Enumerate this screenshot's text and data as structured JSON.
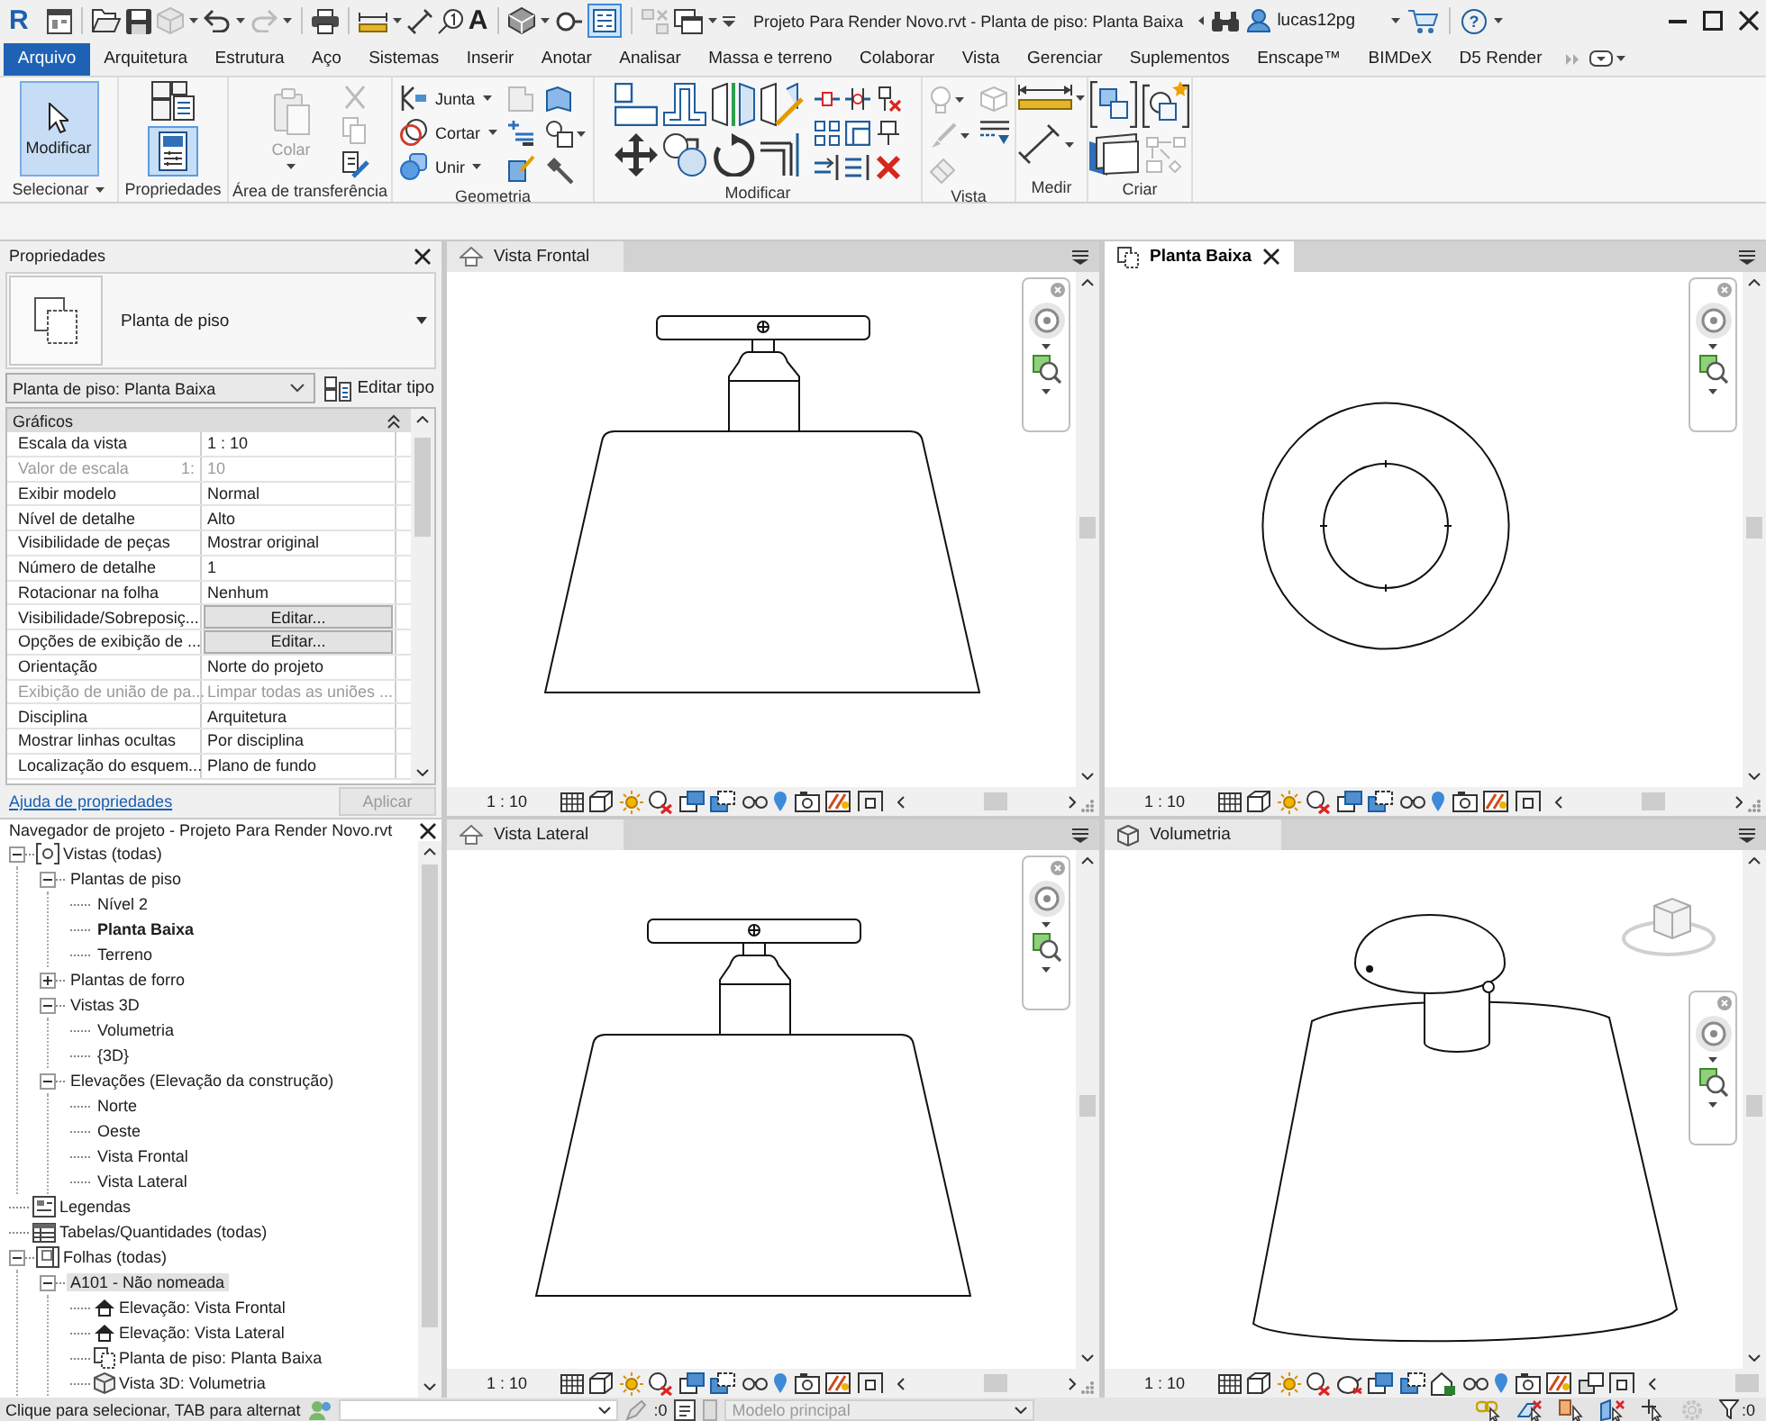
{
  "title_bar": {
    "logo": "R",
    "quick_access": [
      {
        "disabled": false
      },
      {
        "disabled": false
      },
      {
        "disabled": false
      },
      {
        "disabled": true
      },
      {
        "disabled": false
      },
      {
        "disabled": true
      },
      {
        "disabled": false
      },
      {
        "disabled": false
      },
      {
        "disabled": false
      },
      {
        "disabled": false
      },
      {
        "label": "A",
        "disabled": false
      },
      {
        "disabled": false
      },
      {
        "disabled": false
      },
      {
        "disabled": false,
        "on": true
      },
      {
        "disabled": true
      },
      {
        "disabled": false
      }
    ],
    "title": "Projeto Para Render Novo.rvt - Planta de piso: Planta Baixa",
    "user": "lucas12pg",
    "help": "?"
  },
  "ribbon": {
    "file_tab": "Arquivo",
    "tabs": [
      "Arquitetura",
      "Estrutura",
      "Aço",
      "Sistemas",
      "Inserir",
      "Anotar",
      "Analisar",
      "Massa e terreno",
      "Colaborar",
      "Vista",
      "Gerenciar",
      "Suplementos",
      "Enscape™",
      "BIMDeX",
      "D5 Render"
    ],
    "panels": [
      {
        "label": "Selecionar",
        "menu": true,
        "items": [
          {
            "kind": "large",
            "label": "Modificar",
            "selected": true
          }
        ]
      },
      {
        "label": "Propriedades",
        "items": [
          {
            "kind": "icon",
            "selected": false
          },
          {
            "kind": "icon",
            "selected": true
          }
        ]
      },
      {
        "label": "Área de transferência",
        "items": [
          {
            "kind": "large",
            "label": "Colar",
            "disabled": true
          },
          {
            "kind": "icon",
            "disabled": true
          },
          {
            "kind": "icon",
            "disabled": true
          },
          {
            "kind": "icon",
            "disabled": false
          }
        ]
      },
      {
        "label": "Geometria",
        "items": [
          {
            "kind": "split",
            "label": "Junta"
          },
          {
            "kind": "split",
            "label": "Cortar"
          },
          {
            "kind": "split",
            "label": "Unir"
          },
          {
            "kind": "icon",
            "disabled": true
          },
          {
            "kind": "icon",
            "disabled": false
          },
          {
            "kind": "icon",
            "disabled": false
          },
          {
            "kind": "icon",
            "disabled": false
          },
          {
            "kind": "icon",
            "disabled": false
          },
          {
            "kind": "icon",
            "disabled": false
          }
        ]
      },
      {
        "label": "Modificar",
        "items": [
          {
            "kind": "icon",
            "disabled": false
          },
          {
            "kind": "icon",
            "disabled": false
          },
          {
            "kind": "icon",
            "disabled": false
          },
          {
            "kind": "icon",
            "disabled": false
          },
          {
            "kind": "icon",
            "disabled": false
          },
          {
            "kind": "icon",
            "disabled": false
          },
          {
            "kind": "icon",
            "disabled": false
          },
          {
            "kind": "icon",
            "disabled": false
          },
          {
            "kind": "icon",
            "disabled": false
          },
          {
            "kind": "icon",
            "disabled": false
          },
          {
            "kind": "icon",
            "disabled": false
          },
          {
            "kind": "icon",
            "disabled": false
          },
          {
            "kind": "icon",
            "disabled": false
          },
          {
            "kind": "icon",
            "disabled": false
          },
          {
            "kind": "icon",
            "disabled": false
          },
          {
            "kind": "icon",
            "disabled": false
          },
          {
            "kind": "icon",
            "disabled": false
          }
        ]
      },
      {
        "label": "Vista",
        "items": [
          {
            "kind": "icon",
            "disabled": true
          },
          {
            "kind": "icon",
            "disabled": true
          },
          {
            "kind": "icon",
            "disabled": true
          },
          {
            "kind": "icon",
            "disabled": true
          },
          {
            "kind": "icon",
            "disabled": false
          }
        ]
      },
      {
        "label": "Medir",
        "items": [
          {
            "kind": "icon",
            "disabled": false
          },
          {
            "kind": "icon",
            "disabled": false
          }
        ]
      },
      {
        "label": "Criar",
        "items": [
          {
            "kind": "icon",
            "disabled": false
          },
          {
            "kind": "icon",
            "disabled": false
          },
          {
            "kind": "icon",
            "disabled": false
          },
          {
            "kind": "icon",
            "disabled": true
          }
        ]
      }
    ]
  },
  "properties": {
    "title": "Propriedades",
    "type_name": "Planta de piso",
    "instance": "Planta de piso: Planta Baixa",
    "edit_type": "Editar tipo",
    "group": {
      "label": "Gráficos",
      "expanded": true
    },
    "rows": [
      {
        "label": "Escala da vista",
        "value": "1 : 10",
        "kind": "text",
        "disabled": false
      },
      {
        "label": "Valor de escala",
        "label_suffix": "1:",
        "value": "10",
        "kind": "text",
        "disabled": true
      },
      {
        "label": "Exibir modelo",
        "value": "Normal",
        "kind": "text",
        "disabled": false
      },
      {
        "label": "Nível de detalhe",
        "value": "Alto",
        "kind": "text",
        "disabled": false
      },
      {
        "label": "Visibilidade de peças",
        "value": "Mostrar original",
        "kind": "text",
        "disabled": false
      },
      {
        "label": "Número de detalhe",
        "value": "1",
        "kind": "text",
        "disabled": false
      },
      {
        "label": "Rotacionar na folha",
        "value": "Nenhum",
        "kind": "text",
        "disabled": false
      },
      {
        "label": "Visibilidade/Sobreposiç...",
        "value": "Editar...",
        "kind": "button",
        "disabled": false
      },
      {
        "label": "Opções de exibição de ...",
        "value": "Editar...",
        "kind": "button",
        "disabled": false
      },
      {
        "label": "Orientação",
        "value": "Norte do projeto",
        "kind": "text",
        "disabled": false
      },
      {
        "label": "Exibição de união de pa...",
        "value": "Limpar todas as uniões ...",
        "kind": "text",
        "disabled": true
      },
      {
        "label": "Disciplina",
        "value": "Arquitetura",
        "kind": "text",
        "disabled": false
      },
      {
        "label": "Mostrar linhas ocultas",
        "value": "Por disciplina",
        "kind": "text",
        "disabled": false
      },
      {
        "label": "Localização do esquem...",
        "value": "Plano de fundo",
        "kind": "text",
        "disabled": false
      }
    ],
    "help_link": "Ajuda de propriedades",
    "apply": {
      "label": "Aplicar",
      "disabled": true
    }
  },
  "project_browser": {
    "title": "Navegador de projeto - Projeto Para Render Novo.rvt",
    "tree": [
      {
        "label": "Vistas (todas)",
        "kind": "views",
        "expanded": true,
        "selected": false,
        "current": false,
        "children": [
          {
            "label": "Plantas de piso",
            "expanded": true,
            "selected": false,
            "current": false,
            "children": [
              {
                "label": "Nível 2",
                "selected": false,
                "current": false
              },
              {
                "label": "Planta Baixa",
                "selected": false,
                "current": true
              },
              {
                "label": "Terreno",
                "selected": false,
                "current": false
              }
            ]
          },
          {
            "label": "Plantas de forro",
            "expanded": false,
            "selected": false,
            "current": false
          },
          {
            "label": "Vistas 3D",
            "expanded": true,
            "selected": false,
            "current": false,
            "children": [
              {
                "label": "Volumetria",
                "selected": false,
                "current": false
              },
              {
                "label": "{3D}",
                "selected": false,
                "current": false
              }
            ]
          },
          {
            "label": "Elevações (Elevação da construção)",
            "expanded": true,
            "selected": false,
            "current": false,
            "children": [
              {
                "label": "Norte",
                "selected": false,
                "current": false
              },
              {
                "label": "Oeste",
                "selected": false,
                "current": false
              },
              {
                "label": "Vista Frontal",
                "selected": false,
                "current": false
              },
              {
                "label": "Vista Lateral",
                "selected": false,
                "current": false
              }
            ]
          }
        ]
      },
      {
        "label": "Legendas",
        "kind": "legends",
        "selected": false,
        "current": false
      },
      {
        "label": "Tabelas/Quantidades (todas)",
        "kind": "schedules",
        "selected": false,
        "current": false
      },
      {
        "label": "Folhas (todas)",
        "kind": "sheets",
        "expanded": true,
        "selected": false,
        "current": false,
        "children": [
          {
            "label": "A101 - Não nomeada",
            "expanded": true,
            "selected": true,
            "current": false,
            "children": [
              {
                "label": "Elevação: Vista Frontal",
                "kind": "elevation",
                "selected": false,
                "current": false
              },
              {
                "label": "Elevação: Vista Lateral",
                "kind": "elevation",
                "selected": false,
                "current": false
              },
              {
                "label": "Planta de piso: Planta Baixa",
                "kind": "plan",
                "selected": false,
                "current": false
              },
              {
                "label": "Vista 3D: Volumetria",
                "kind": "perspective",
                "selected": false,
                "current": false
              }
            ]
          }
        ]
      }
    ]
  },
  "views": [
    {
      "title": "Vista Frontal",
      "kind": "elevation",
      "selected": false,
      "scale": "1 : 10"
    },
    {
      "title": "Planta Baixa",
      "kind": "plan",
      "selected": true,
      "scale": "1 : 10"
    },
    {
      "title": "Vista Lateral",
      "kind": "elevation",
      "selected": false,
      "scale": "1 : 10"
    },
    {
      "title": "Volumetria",
      "kind": "perspective",
      "selected": false,
      "scale": "1 : 10"
    }
  ],
  "status_bar": {
    "hint": "Clique para selecionar, TAB para alternat",
    "counter_1": ":0",
    "design_option": {
      "value": "Modelo principal",
      "disabled": true
    },
    "counter_2": ":0"
  }
}
